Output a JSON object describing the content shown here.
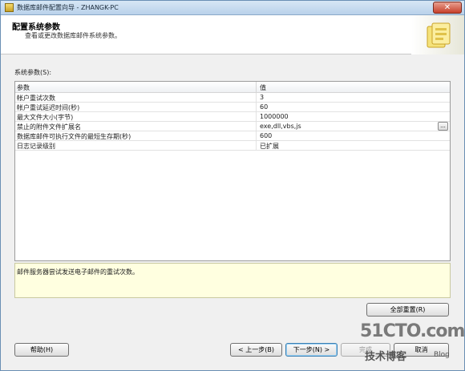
{
  "window": {
    "title": "数据库邮件配置向导 - ZHANGK-PC",
    "close_label": "✕"
  },
  "header": {
    "title": "配置系统参数",
    "subtitle": "查看或更改数据库邮件系统参数。"
  },
  "params": {
    "label": "系统参数(S):",
    "columns": [
      "参数",
      "值"
    ],
    "rows": [
      {
        "name": "帐户重试次数",
        "value": "3"
      },
      {
        "name": "帐户重试延迟时间(秒)",
        "value": "60"
      },
      {
        "name": "最大文件大小(字节)",
        "value": "1000000"
      },
      {
        "name": "禁止的附件文件扩展名",
        "value": "exe,dll,vbs,js",
        "has_ellipsis": true,
        "ellipsis_label": "..."
      },
      {
        "name": "数据库邮件可执行文件的最短生存期(秒)",
        "value": "600"
      },
      {
        "name": "日志记录级别",
        "value": "已扩展"
      }
    ]
  },
  "description": {
    "text": "邮件服务器尝试发送电子邮件的重试次数。"
  },
  "buttons": {
    "reset_all": "全部重置(R)",
    "help": "帮助(H)",
    "back": "< 上一步(B)",
    "next": "下一步(N) >",
    "finish": "完成",
    "cancel": "取消"
  },
  "watermark": {
    "site": "51CTO.com",
    "tagline": "技术博客",
    "blog": "Blog"
  }
}
